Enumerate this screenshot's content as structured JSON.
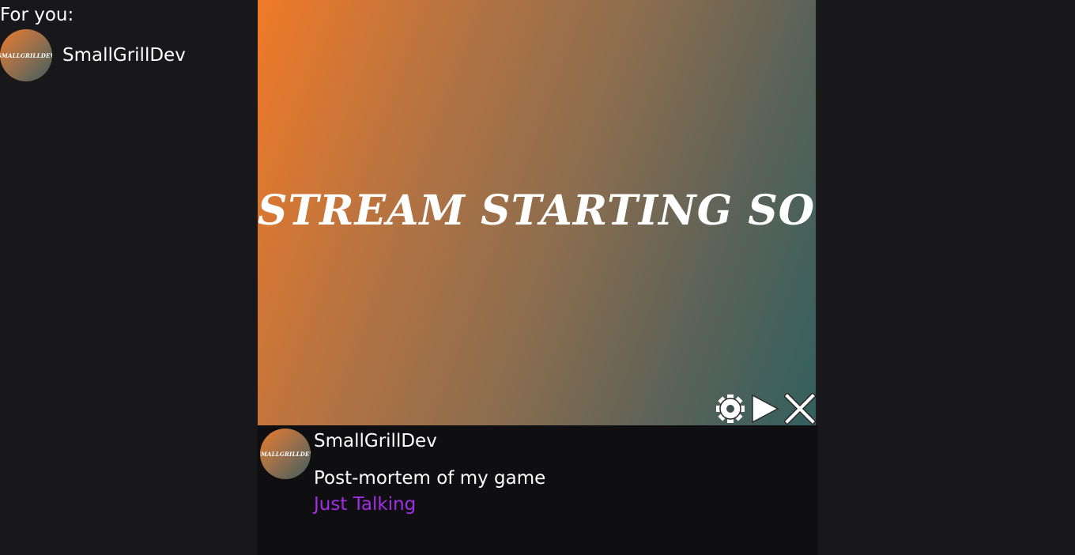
{
  "sidebar": {
    "heading": "For you:",
    "channels": [
      {
        "name": "SmallGrillDev",
        "avatar_text": "SMALLGRILLDEV"
      }
    ]
  },
  "player": {
    "overlay_text": "STREAM STARTING SOON!",
    "controls": {
      "settings_icon": "gear-icon",
      "play_icon": "play-icon",
      "close_icon": "close-icon"
    }
  },
  "stream_info": {
    "channel_name": "SmallGrillDev",
    "avatar_text": "SMALLGRILLDEV",
    "title": "Post-mortem of my game",
    "category": "Just Talking"
  },
  "colors": {
    "background": "#18181a",
    "info_background": "#0f0f11",
    "category_accent": "#a42ee8"
  }
}
